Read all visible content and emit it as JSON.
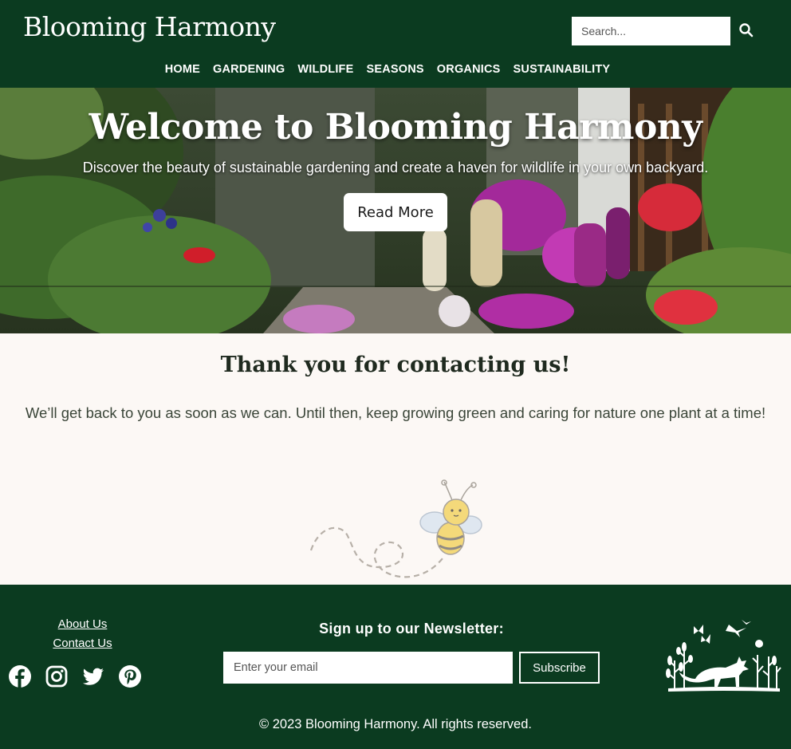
{
  "header": {
    "logo": "Blooming Harmony",
    "search_placeholder": "Search...",
    "nav": [
      "HOME",
      "GARDENING",
      "WILDLIFE",
      "SEASONS",
      "ORGANICS",
      "SUSTAINABILITY"
    ]
  },
  "hero": {
    "title": "Welcome to Blooming Harmony",
    "subtitle": "Discover the beauty of sustainable gardening and create a haven for wildlife in your own backyard.",
    "button": "Read More"
  },
  "main": {
    "title": "Thank you for contacting us!",
    "text": "We’ll get back to you as soon as we can. Until then, keep growing green and caring for nature one plant at a time!"
  },
  "footer": {
    "links": [
      "About Us",
      "Contact Us"
    ],
    "newsletter_title": "Sign up to our Newsletter:",
    "email_placeholder": "Enter your email",
    "subscribe": "Subscribe",
    "copyright": "© 2023 Blooming Harmony. All rights reserved.",
    "social_icons": [
      "facebook-icon",
      "instagram-icon",
      "twitter-icon",
      "pinterest-icon"
    ]
  },
  "colors": {
    "brand_green": "#0b3b20",
    "cream": "#fcf8f5"
  }
}
